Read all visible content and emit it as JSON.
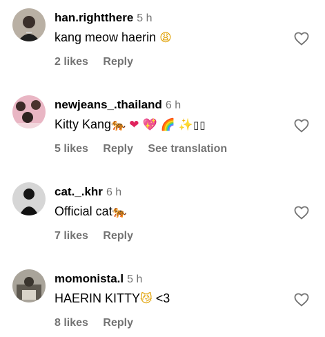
{
  "comments": [
    {
      "username": "han.rightthere",
      "time": "5 h",
      "text": "kang meow haerin",
      "emojis": [
        {
          "glyph": "😩",
          "kind": "face"
        }
      ],
      "likes": "2 likes",
      "reply": "Reply",
      "translate": ""
    },
    {
      "username": "newjeans_.thailand",
      "time": "6 h",
      "text": "Kitty Kang",
      "emojis": [
        {
          "glyph": "🐅",
          "kind": "tiger"
        },
        {
          "glyph": "❤",
          "kind": "heart"
        },
        {
          "glyph": "💖",
          "kind": "heart"
        },
        {
          "glyph": "🌈",
          "kind": "rainbow"
        },
        {
          "glyph": "✨",
          "kind": "sparkle"
        },
        {
          "glyph": "▯▯",
          "kind": "box"
        }
      ],
      "likes": "5 likes",
      "reply": "Reply",
      "translate": "See translation"
    },
    {
      "username": "cat._.khr",
      "time": "6 h",
      "text": "Official cat",
      "emojis": [
        {
          "glyph": "🐅",
          "kind": "tiger"
        }
      ],
      "likes": "7 likes",
      "reply": "Reply",
      "translate": ""
    },
    {
      "username": "momonista.l",
      "time": "5 h",
      "text": "HAERIN KITTY",
      "emojis": [
        {
          "glyph": "😼",
          "kind": "face"
        }
      ],
      "suffix": " <3",
      "likes": "8 likes",
      "reply": "Reply",
      "translate": ""
    }
  ],
  "colors": {
    "secondary_text": "#737373",
    "heart_outline": "#737373"
  }
}
